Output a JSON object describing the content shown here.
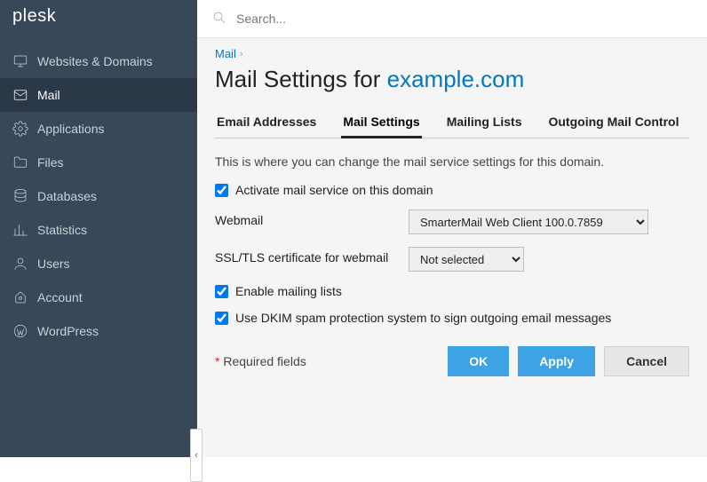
{
  "brand": "plesk",
  "search": {
    "placeholder": "Search..."
  },
  "sidebar": {
    "items": [
      {
        "label": "Websites & Domains",
        "icon": "monitor"
      },
      {
        "label": "Mail",
        "icon": "envelope",
        "active": true
      },
      {
        "label": "Applications",
        "icon": "gear"
      },
      {
        "label": "Files",
        "icon": "folder"
      },
      {
        "label": "Databases",
        "icon": "database"
      },
      {
        "label": "Statistics",
        "icon": "chart"
      },
      {
        "label": "Users",
        "icon": "user"
      },
      {
        "label": "Account",
        "icon": "account"
      },
      {
        "label": "WordPress",
        "icon": "wordpress"
      }
    ]
  },
  "breadcrumb": {
    "parent": "Mail"
  },
  "title": {
    "prefix": "Mail Settings for ",
    "domain": "example.com"
  },
  "tabs": [
    {
      "label": "Email Addresses"
    },
    {
      "label": "Mail Settings",
      "active": true
    },
    {
      "label": "Mailing Lists"
    },
    {
      "label": "Outgoing Mail Control"
    }
  ],
  "description": "This is where you can change the mail service settings for this domain.",
  "form": {
    "activate_label": "Activate mail service on this domain",
    "activate_checked": true,
    "webmail_label": "Webmail",
    "webmail_value": "SmarterMail Web Client 100.0.7859",
    "ssl_label": "SSL/TLS certificate for webmail",
    "ssl_value": "Not selected",
    "mailing_lists_label": "Enable mailing lists",
    "mailing_lists_checked": true,
    "dkim_label": "Use DKIM spam protection system to sign outgoing email messages",
    "dkim_checked": true,
    "required_label": "Required fields",
    "required_star": "*",
    "buttons": {
      "ok": "OK",
      "apply": "Apply",
      "cancel": "Cancel"
    }
  }
}
